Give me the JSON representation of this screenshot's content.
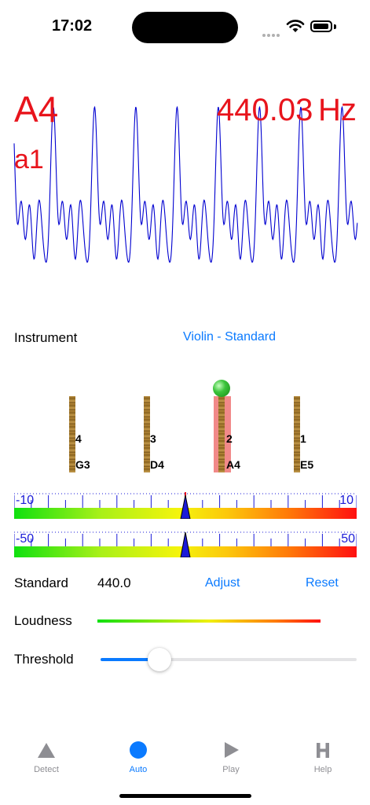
{
  "status": {
    "time": "17:02"
  },
  "note": {
    "name": "A4",
    "alt_name": "a1",
    "frequency": "440.03",
    "unit": "Hz"
  },
  "instrument": {
    "label": "Instrument",
    "value": "Violin - Standard"
  },
  "strings": [
    {
      "number": "4",
      "note": "G3",
      "active": false
    },
    {
      "number": "3",
      "note": "D4",
      "active": false
    },
    {
      "number": "2",
      "note": "A4",
      "active": true
    },
    {
      "number": "1",
      "note": "E5",
      "active": false
    }
  ],
  "meter_fine": {
    "min_label": "-10",
    "max_label": "10",
    "value": 0
  },
  "meter_coarse": {
    "min_label": "-50",
    "max_label": "50",
    "value": 0
  },
  "standard": {
    "label": "Standard",
    "value": "440.0",
    "adjust_label": "Adjust",
    "reset_label": "Reset"
  },
  "loudness": {
    "label": "Loudness",
    "level": 0.86
  },
  "threshold": {
    "label": "Threshold",
    "value": 0.23
  },
  "tabs": [
    {
      "label": "Detect",
      "icon": "triangle-icon",
      "active": false
    },
    {
      "label": "Auto",
      "icon": "circle-icon",
      "active": true
    },
    {
      "label": "Play",
      "icon": "play-icon",
      "active": false
    },
    {
      "label": "Help",
      "icon": "h-icon",
      "active": false
    }
  ],
  "colors": {
    "note_red": "#e8141c",
    "accent_blue": "#0a7aff",
    "wave_blue": "#0000d0",
    "meter_text": "#1a1ad8"
  }
}
